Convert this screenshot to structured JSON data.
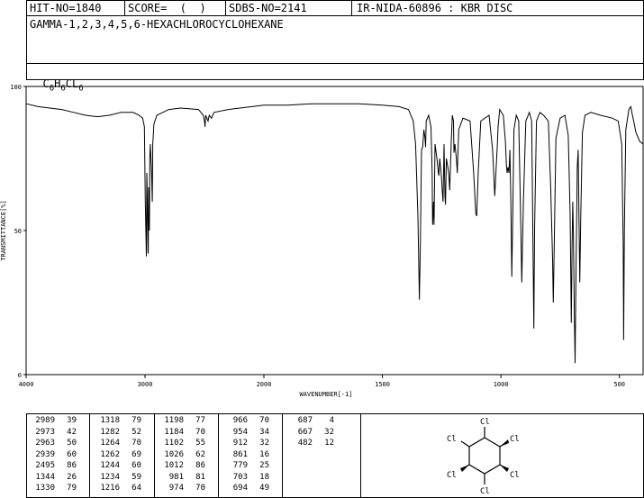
{
  "header": {
    "hit_no": "HIT-NO=1840",
    "score": "SCORE=  (  )",
    "sdbs_no": "SDBS-NO=2141",
    "method": "IR-NIDA-60896 : KBR DISC",
    "compound_name": "GAMMA-1,2,3,4,5,6-HEXACHLOROCYCLOHEXANE",
    "formula": "C6H6CL6"
  },
  "chart_data": {
    "type": "line",
    "xlabel": "WAVENUMBER[-1]",
    "ylabel": "TRANSMITTANCE[%]",
    "xlim": [
      4000,
      400
    ],
    "ylim": [
      0,
      100
    ],
    "x_ticks": [
      "4000",
      "3000",
      "2000",
      "1500",
      "1000",
      "500"
    ],
    "y_ticks": [
      "100",
      "50",
      "0"
    ],
    "series": [
      {
        "points": [
          [
            4000,
            94
          ],
          [
            3900,
            93
          ],
          [
            3800,
            92.5
          ],
          [
            3700,
            92
          ],
          [
            3600,
            91
          ],
          [
            3500,
            90
          ],
          [
            3400,
            89.5
          ],
          [
            3300,
            90
          ],
          [
            3200,
            91
          ],
          [
            3100,
            91
          ],
          [
            3050,
            90
          ],
          [
            3020,
            89
          ],
          [
            3005,
            86
          ],
          [
            2998,
            60
          ],
          [
            2989,
            41
          ],
          [
            2985,
            70
          ],
          [
            2980,
            60
          ],
          [
            2975,
            43
          ],
          [
            2973,
            42
          ],
          [
            2970,
            65
          ],
          [
            2965,
            55
          ],
          [
            2963,
            50
          ],
          [
            2960,
            75
          ],
          [
            2955,
            80
          ],
          [
            2945,
            70
          ],
          [
            2939,
            60
          ],
          [
            2935,
            80
          ],
          [
            2925,
            87
          ],
          [
            2900,
            90
          ],
          [
            2800,
            92
          ],
          [
            2700,
            92.5
          ],
          [
            2550,
            92
          ],
          [
            2510,
            90
          ],
          [
            2500,
            88
          ],
          [
            2495,
            86
          ],
          [
            2490,
            90
          ],
          [
            2470,
            88
          ],
          [
            2460,
            90
          ],
          [
            2440,
            89
          ],
          [
            2420,
            91
          ],
          [
            2300,
            92
          ],
          [
            2100,
            93
          ],
          [
            2000,
            93.5
          ],
          [
            1900,
            93.5
          ],
          [
            1800,
            94
          ],
          [
            1700,
            94
          ],
          [
            1600,
            94
          ],
          [
            1500,
            93.5
          ],
          [
            1430,
            93
          ],
          [
            1390,
            92
          ],
          [
            1370,
            88
          ],
          [
            1360,
            80
          ],
          [
            1350,
            55
          ],
          [
            1346,
            35
          ],
          [
            1344,
            26
          ],
          [
            1340,
            45
          ],
          [
            1335,
            78
          ],
          [
            1330,
            79
          ],
          [
            1325,
            85
          ],
          [
            1320,
            82
          ],
          [
            1318,
            79
          ],
          [
            1315,
            88
          ],
          [
            1305,
            90
          ],
          [
            1295,
            86
          ],
          [
            1290,
            70
          ],
          [
            1288,
            52
          ],
          [
            1284,
            60
          ],
          [
            1282,
            52
          ],
          [
            1278,
            80
          ],
          [
            1270,
            75
          ],
          [
            1264,
            70
          ],
          [
            1262,
            69
          ],
          [
            1258,
            75
          ],
          [
            1252,
            70
          ],
          [
            1246,
            62
          ],
          [
            1244,
            60
          ],
          [
            1240,
            80
          ],
          [
            1236,
            62
          ],
          [
            1234,
            59
          ],
          [
            1230,
            75
          ],
          [
            1220,
            70
          ],
          [
            1216,
            64
          ],
          [
            1210,
            80
          ],
          [
            1205,
            90
          ],
          [
            1200,
            88
          ],
          [
            1198,
            77
          ],
          [
            1194,
            80
          ],
          [
            1188,
            75
          ],
          [
            1184,
            70
          ],
          [
            1178,
            85
          ],
          [
            1160,
            89
          ],
          [
            1130,
            88
          ],
          [
            1115,
            70
          ],
          [
            1106,
            56
          ],
          [
            1102,
            55
          ],
          [
            1096,
            70
          ],
          [
            1085,
            88
          ],
          [
            1050,
            90
          ],
          [
            1035,
            78
          ],
          [
            1026,
            62
          ],
          [
            1015,
            80
          ],
          [
            1012,
            86
          ],
          [
            1005,
            92
          ],
          [
            990,
            90
          ],
          [
            981,
            81
          ],
          [
            977,
            73
          ],
          [
            974,
            70
          ],
          [
            970,
            72
          ],
          [
            966,
            70
          ],
          [
            962,
            78
          ],
          [
            958,
            60
          ],
          [
            954,
            34
          ],
          [
            950,
            55
          ],
          [
            945,
            85
          ],
          [
            935,
            90
          ],
          [
            925,
            88
          ],
          [
            918,
            60
          ],
          [
            912,
            32
          ],
          [
            905,
            60
          ],
          [
            895,
            88
          ],
          [
            880,
            91
          ],
          [
            870,
            88
          ],
          [
            864,
            40
          ],
          [
            861,
            16
          ],
          [
            858,
            50
          ],
          [
            850,
            88
          ],
          [
            835,
            91
          ],
          [
            820,
            90
          ],
          [
            800,
            88
          ],
          [
            790,
            65
          ],
          [
            782,
            40
          ],
          [
            779,
            25
          ],
          [
            776,
            40
          ],
          [
            768,
            82
          ],
          [
            750,
            89
          ],
          [
            730,
            90
          ],
          [
            716,
            83
          ],
          [
            712,
            70
          ],
          [
            708,
            55
          ],
          [
            703,
            18
          ],
          [
            700,
            44
          ],
          [
            697,
            60
          ],
          [
            694,
            49
          ],
          [
            690,
            20
          ],
          [
            687,
            4
          ],
          [
            684,
            30
          ],
          [
            678,
            72
          ],
          [
            674,
            78
          ],
          [
            667,
            32
          ],
          [
            663,
            55
          ],
          [
            656,
            84
          ],
          [
            645,
            90
          ],
          [
            620,
            91
          ],
          [
            580,
            90
          ],
          [
            530,
            89
          ],
          [
            505,
            88
          ],
          [
            490,
            80
          ],
          [
            484,
            45
          ],
          [
            482,
            12
          ],
          [
            479,
            50
          ],
          [
            473,
            85
          ],
          [
            460,
            92
          ],
          [
            452,
            93
          ],
          [
            445,
            90
          ],
          [
            430,
            84
          ],
          [
            415,
            81
          ],
          [
            400,
            80
          ]
        ]
      }
    ]
  },
  "peak_table": {
    "columns": [
      [
        [
          "2989",
          "39"
        ],
        [
          "2973",
          "42"
        ],
        [
          "2963",
          "50"
        ],
        [
          "2939",
          "60"
        ],
        [
          "2495",
          "86"
        ],
        [
          "1344",
          "26"
        ],
        [
          "1330",
          "79"
        ]
      ],
      [
        [
          "1318",
          "79"
        ],
        [
          "1282",
          "52"
        ],
        [
          "1264",
          "70"
        ],
        [
          "1262",
          "69"
        ],
        [
          "1244",
          "60"
        ],
        [
          "1234",
          "59"
        ],
        [
          "1216",
          "64"
        ]
      ],
      [
        [
          "1198",
          "77"
        ],
        [
          "1184",
          "70"
        ],
        [
          "1102",
          "55"
        ],
        [
          "1026",
          "62"
        ],
        [
          "1012",
          "86"
        ],
        [
          "981",
          "81"
        ],
        [
          "974",
          "70"
        ]
      ],
      [
        [
          "966",
          "70"
        ],
        [
          "954",
          "34"
        ],
        [
          "912",
          "32"
        ],
        [
          "861",
          "16"
        ],
        [
          "779",
          "25"
        ],
        [
          "703",
          "18"
        ],
        [
          "694",
          "49"
        ]
      ],
      [
        [
          "687",
          "4"
        ],
        [
          "667",
          "32"
        ],
        [
          "482",
          "12"
        ]
      ]
    ]
  },
  "structure": {
    "atom_labels": [
      "Cl",
      "Cl",
      "Cl",
      "Cl",
      "Cl",
      "Cl"
    ]
  }
}
